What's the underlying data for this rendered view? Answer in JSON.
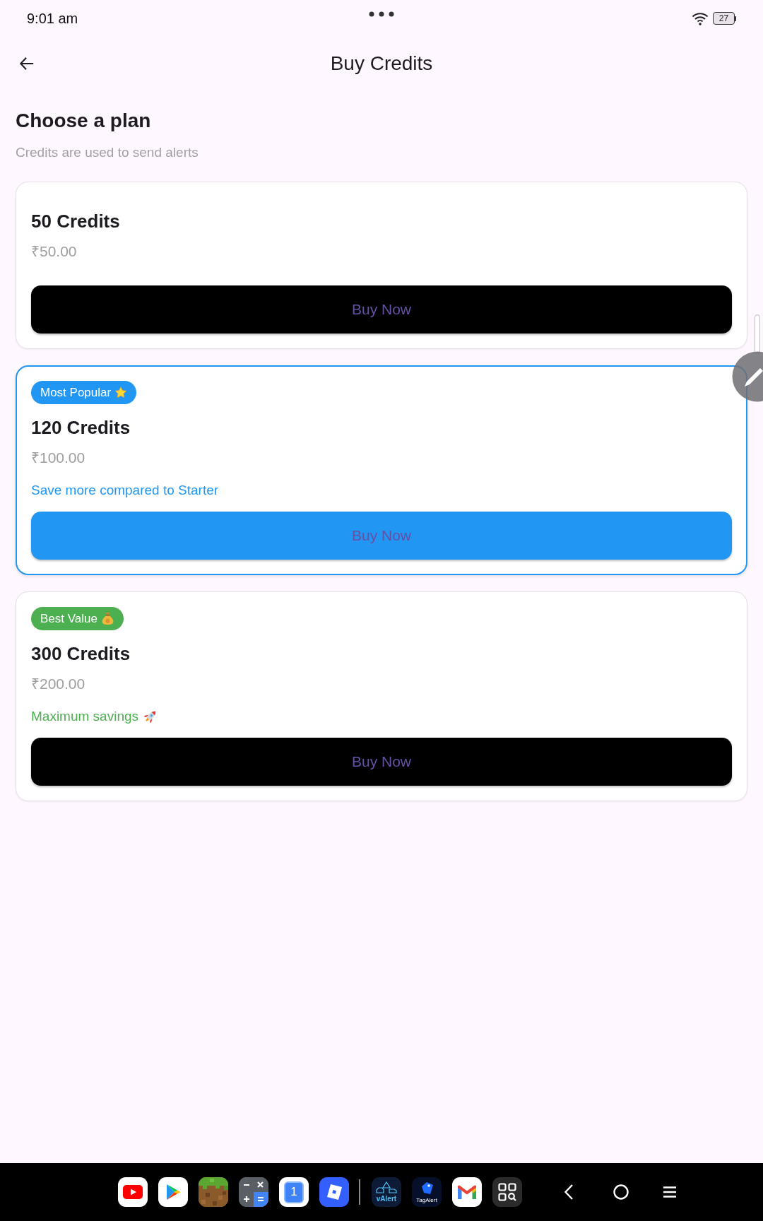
{
  "status_bar": {
    "time": "9:01 am",
    "battery": "27"
  },
  "app_bar": {
    "title": "Buy Credits"
  },
  "intro": {
    "heading": "Choose a plan",
    "subtitle": "Credits are used to send alerts"
  },
  "plans": [
    {
      "kind": "basic",
      "title": "50 Credits",
      "price": "₹50.00",
      "highlighted": false,
      "button": "Buy Now"
    },
    {
      "kind": "popular",
      "badge": "Most Popular",
      "color": "#2196f3",
      "title": "120 Credits",
      "price": "₹100.00",
      "note": "Save more compared to Starter",
      "highlighted": true,
      "button": "Buy Now"
    },
    {
      "kind": "value",
      "badge": "Best Value",
      "color": "#4caf50",
      "title": "300 Credits",
      "price": "₹200.00",
      "note": "Maximum savings",
      "highlighted": false,
      "button": "Buy Now"
    }
  ],
  "dock": {
    "pinned": [
      {
        "kind": "video"
      },
      {
        "kind": "store"
      },
      {
        "kind": "block"
      },
      {
        "kind": "calculator"
      },
      {
        "kind": "calendar",
        "label": "1"
      },
      {
        "kind": "tilted_square"
      }
    ],
    "recent": [
      {
        "kind": "car_alert",
        "label": "vAlert"
      },
      {
        "kind": "tag",
        "label": "TagAlert"
      },
      {
        "kind": "mail"
      },
      {
        "kind": "scanner"
      }
    ]
  }
}
